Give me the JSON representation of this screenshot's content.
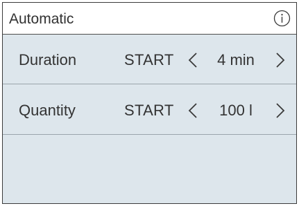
{
  "header": {
    "title": "Automatic",
    "info_icon": "info-circle-icon"
  },
  "rows": [
    {
      "label": "Duration",
      "start_label": "START",
      "value": "4 min",
      "prev_icon": "chevron-left-icon",
      "next_icon": "chevron-right-icon"
    },
    {
      "label": "Quantity",
      "start_label": "START",
      "value": "100 l",
      "prev_icon": "chevron-left-icon",
      "next_icon": "chevron-right-icon"
    }
  ],
  "colors": {
    "panel_background": "#dde6ec",
    "header_background": "#ffffff",
    "text": "#333333",
    "border": "#3b3b3b"
  }
}
